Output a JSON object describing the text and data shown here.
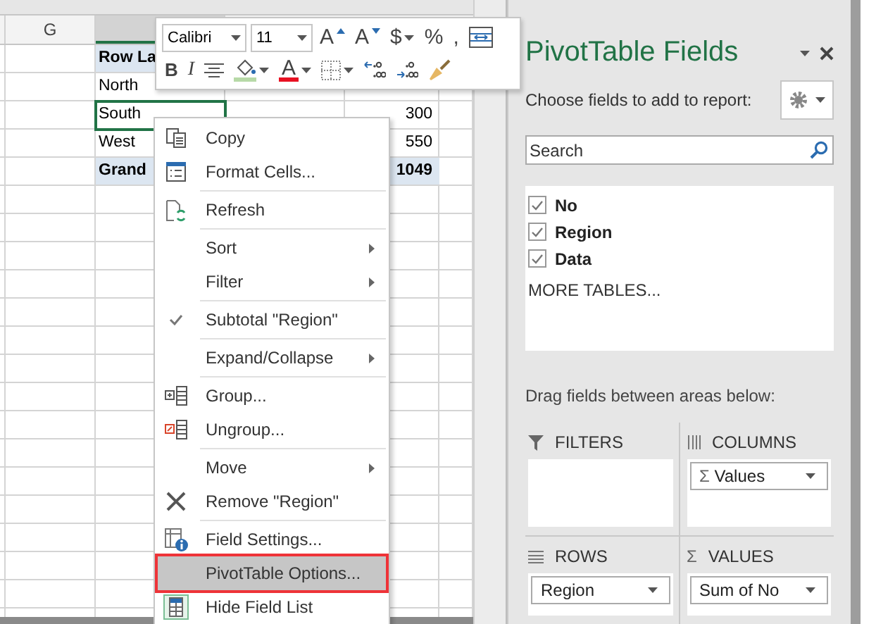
{
  "sheet": {
    "column_header": "G",
    "rows": [
      {
        "label": "Row La",
        "value": "",
        "kind": "header",
        "selected": false
      },
      {
        "label": "North",
        "value": "",
        "kind": "item",
        "selected": false
      },
      {
        "label": "South",
        "value": "300",
        "kind": "item",
        "selected": true
      },
      {
        "label": "West",
        "value": "550",
        "kind": "item",
        "selected": false
      },
      {
        "label": "Grand",
        "value": "1049",
        "kind": "total",
        "selected": false
      }
    ]
  },
  "mini_toolbar": {
    "font": "Calibri",
    "size": "11",
    "rows": [
      [
        {
          "kind": "grow",
          "label": "A"
        },
        {
          "kind": "shrink",
          "label": "A"
        },
        {
          "kind": "currency",
          "label": "$",
          "dropdown": true
        },
        {
          "kind": "percent",
          "label": "%"
        },
        {
          "kind": "comma",
          "label": ","
        },
        {
          "kind": "wrap"
        }
      ],
      [
        {
          "kind": "bold",
          "label": "B"
        },
        {
          "kind": "italic",
          "label": "I"
        },
        {
          "kind": "align"
        },
        {
          "kind": "fill",
          "dropdown": true
        },
        {
          "kind": "font-color",
          "label": "A",
          "dropdown": true
        },
        {
          "kind": "borders",
          "dropdown": true
        },
        {
          "kind": "decrease-decimal"
        },
        {
          "kind": "increase-decimal"
        },
        {
          "kind": "format-painter"
        }
      ]
    ]
  },
  "context_menu": {
    "groups": [
      [
        {
          "label": "Copy",
          "kind": "copy",
          "submenu": false,
          "checked": false,
          "selected": false
        },
        {
          "label": "Format Cells...",
          "kind": "format",
          "submenu": false,
          "checked": false,
          "selected": false
        }
      ],
      [
        {
          "label": "Refresh",
          "kind": "refresh",
          "submenu": false,
          "checked": false,
          "selected": false
        }
      ],
      [
        {
          "label": "Sort",
          "kind": "plain",
          "submenu": true,
          "checked": false,
          "selected": false
        },
        {
          "label": "Filter",
          "kind": "plain",
          "submenu": true,
          "checked": false,
          "selected": false
        }
      ],
      [
        {
          "label": "Subtotal \"Region\"",
          "kind": "plain",
          "submenu": false,
          "checked": true,
          "selected": false
        }
      ],
      [
        {
          "label": "Expand/Collapse",
          "kind": "plain",
          "submenu": true,
          "checked": false,
          "selected": false
        }
      ],
      [
        {
          "label": "Group...",
          "kind": "group",
          "submenu": false,
          "checked": false,
          "selected": false
        },
        {
          "label": "Ungroup...",
          "kind": "ungroup",
          "submenu": false,
          "checked": false,
          "selected": false
        }
      ],
      [
        {
          "label": "Move",
          "kind": "plain",
          "submenu": true,
          "checked": false,
          "selected": false
        },
        {
          "label": "Remove \"Region\"",
          "kind": "remove",
          "submenu": false,
          "checked": false,
          "selected": false
        }
      ],
      [
        {
          "label": "Field Settings...",
          "kind": "field-settings",
          "submenu": false,
          "checked": false,
          "selected": false
        },
        {
          "label": "PivotTable Options...",
          "kind": "plain",
          "submenu": false,
          "checked": false,
          "selected": true
        },
        {
          "label": "Hide Field List",
          "kind": "hide-list",
          "submenu": false,
          "checked": false,
          "selected": false
        }
      ]
    ]
  },
  "pane": {
    "title": "PivotTable Fields",
    "subtitle": "Choose fields to add to report:",
    "search": {
      "placeholder": "Search"
    },
    "fields": [
      {
        "label": "No",
        "checked": true
      },
      {
        "label": "Region",
        "checked": true
      },
      {
        "label": "Data",
        "checked": true
      }
    ],
    "more_tables": "MORE TABLES...",
    "areas_hint": "Drag fields between areas below:",
    "areas": [
      {
        "kind": "filters",
        "title": "FILTERS"
      },
      {
        "kind": "columns",
        "title": "COLUMNS",
        "items": [
          {
            "symbol": "Σ",
            "label": "Values"
          }
        ]
      },
      {
        "kind": "rows",
        "title": "ROWS",
        "items": [
          {
            "label": "Region"
          }
        ]
      },
      {
        "kind": "values",
        "symbol": "Σ",
        "title": "VALUES",
        "items": [
          {
            "label": "Sum of No"
          }
        ]
      }
    ]
  }
}
